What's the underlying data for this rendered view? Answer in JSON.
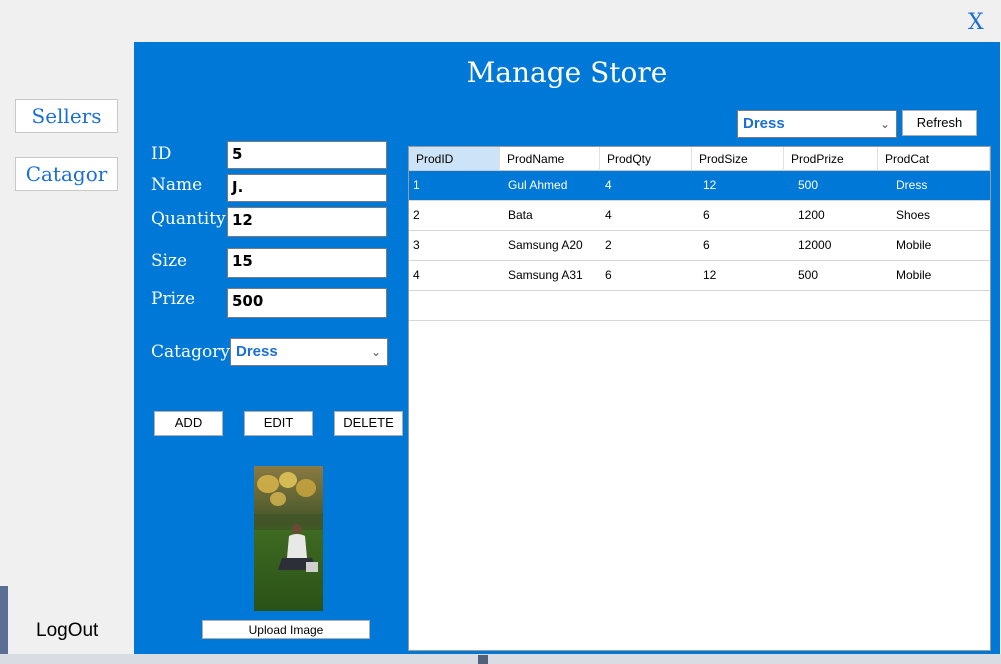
{
  "window": {
    "close_label": "X"
  },
  "sidebar": {
    "sellers_label": "Sellers",
    "categories_label": "Catagor",
    "logout_label": "LogOut"
  },
  "main": {
    "title": "Manage Store",
    "form": {
      "id_label": "ID",
      "id_value": "5",
      "name_label": "Name",
      "name_value": "J.",
      "quantity_label": "Quantity",
      "quantity_value": "12",
      "size_label": "Size",
      "size_value": "15",
      "prize_label": "Prize",
      "prize_value": "500",
      "category_label": "Catagory",
      "category_value": "Dress"
    },
    "buttons": {
      "add": "ADD",
      "edit": "EDIT",
      "delete": "DELETE",
      "upload": "Upload Image"
    },
    "filter": {
      "value": "Dress",
      "refresh_label": "Refresh"
    },
    "grid": {
      "columns": [
        "ProdID",
        "ProdName",
        "ProdQty",
        "ProdSize",
        "ProdPrize",
        "ProdCat"
      ],
      "rows": [
        [
          "1",
          "Gul Ahmed",
          "4",
          "12",
          "500",
          "Dress"
        ],
        [
          "2",
          "Bata",
          "4",
          "6",
          "1200",
          "Shoes"
        ],
        [
          "3",
          "Samsung A20",
          "2",
          "6",
          "12000",
          "Mobile"
        ],
        [
          "4",
          "Samsung A31",
          "6",
          "12",
          "500",
          "Mobile"
        ]
      ],
      "selected_row": 0
    }
  },
  "colors": {
    "panel": "#0078d7",
    "accent_text": "#1a6fd6",
    "selected_row": "#0078d7"
  },
  "icons": {
    "dropdown": "chevron-down-icon",
    "close": "close-icon"
  }
}
